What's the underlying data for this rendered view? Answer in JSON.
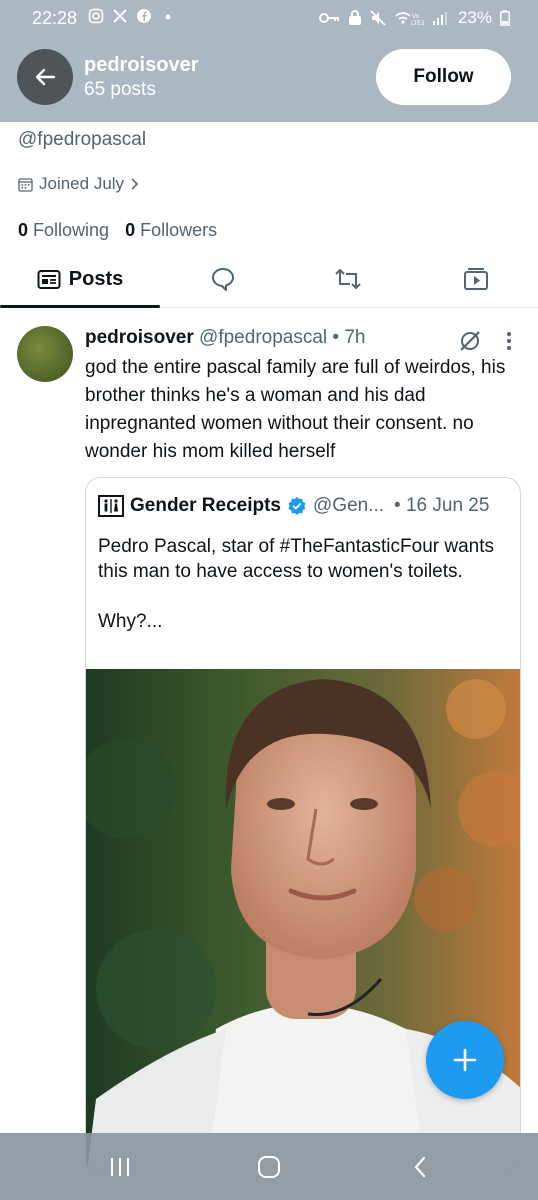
{
  "status_bar": {
    "time": "22:28",
    "battery": "23%"
  },
  "header": {
    "name": "pedroisover",
    "post_count": "65 posts",
    "follow_label": "Follow"
  },
  "profile": {
    "handle": "@fpedropascal",
    "joined": "Joined July",
    "following_count": "0",
    "following_label": "Following",
    "followers_count": "0",
    "followers_label": "Followers"
  },
  "tabs": {
    "posts_label": "Posts"
  },
  "tweet": {
    "name": "pedroisover",
    "meta": "@fpedropascal • 7h",
    "text": "god the entire pascal family are full of weirdos, his brother thinks he's a woman and his dad inpregnanted women without their consent. no wonder his mom killed herself"
  },
  "quoted": {
    "name": "Gender Receipts",
    "handle": "@Gen...",
    "date": "• 16 Jun 25",
    "text": "Pedro Pascal, star of #TheFantasticFour wants this man to have access to women's toilets.\n\nWhy?..."
  },
  "colors": {
    "header_bg": "#aab8c2",
    "accent": "#1d9bf0",
    "muted_text": "#536471"
  }
}
